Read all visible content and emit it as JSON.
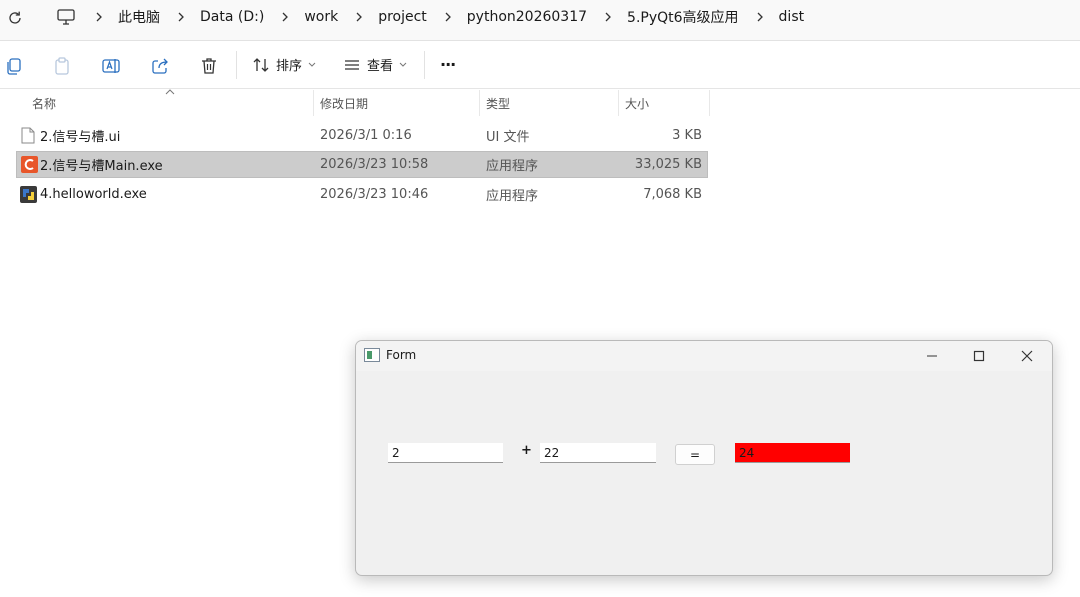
{
  "address_bar": {
    "breadcrumbs": [
      "此电脑",
      "Data (D:)",
      "work",
      "project",
      "python20260317",
      "5.PyQt6高级应用",
      "dist"
    ]
  },
  "toolbar": {
    "sort_label": "排序",
    "view_label": "查看",
    "more_label": "···"
  },
  "file_list": {
    "columns": {
      "name": "名称",
      "modified": "修改日期",
      "type": "类型",
      "size": "大小"
    },
    "rows": [
      {
        "name": "2.信号与槽.ui",
        "modified": "2026/3/1 0:16",
        "type": "UI 文件",
        "size": "3 KB",
        "icon": "document-icon",
        "selected": false
      },
      {
        "name": "2.信号与槽Main.exe",
        "modified": "2026/3/23 10:58",
        "type": "应用程序",
        "size": "33,025 KB",
        "icon": "app-c-icon",
        "selected": true
      },
      {
        "name": "4.helloworld.exe",
        "modified": "2026/3/23 10:46",
        "type": "应用程序",
        "size": "7,068 KB",
        "icon": "python-app-icon",
        "selected": false
      }
    ]
  },
  "form_window": {
    "title": "Form",
    "operand1": "2",
    "operator": "+",
    "operand2": "22",
    "equals_label": "=",
    "result": "24",
    "result_bg": "#ff0000"
  }
}
